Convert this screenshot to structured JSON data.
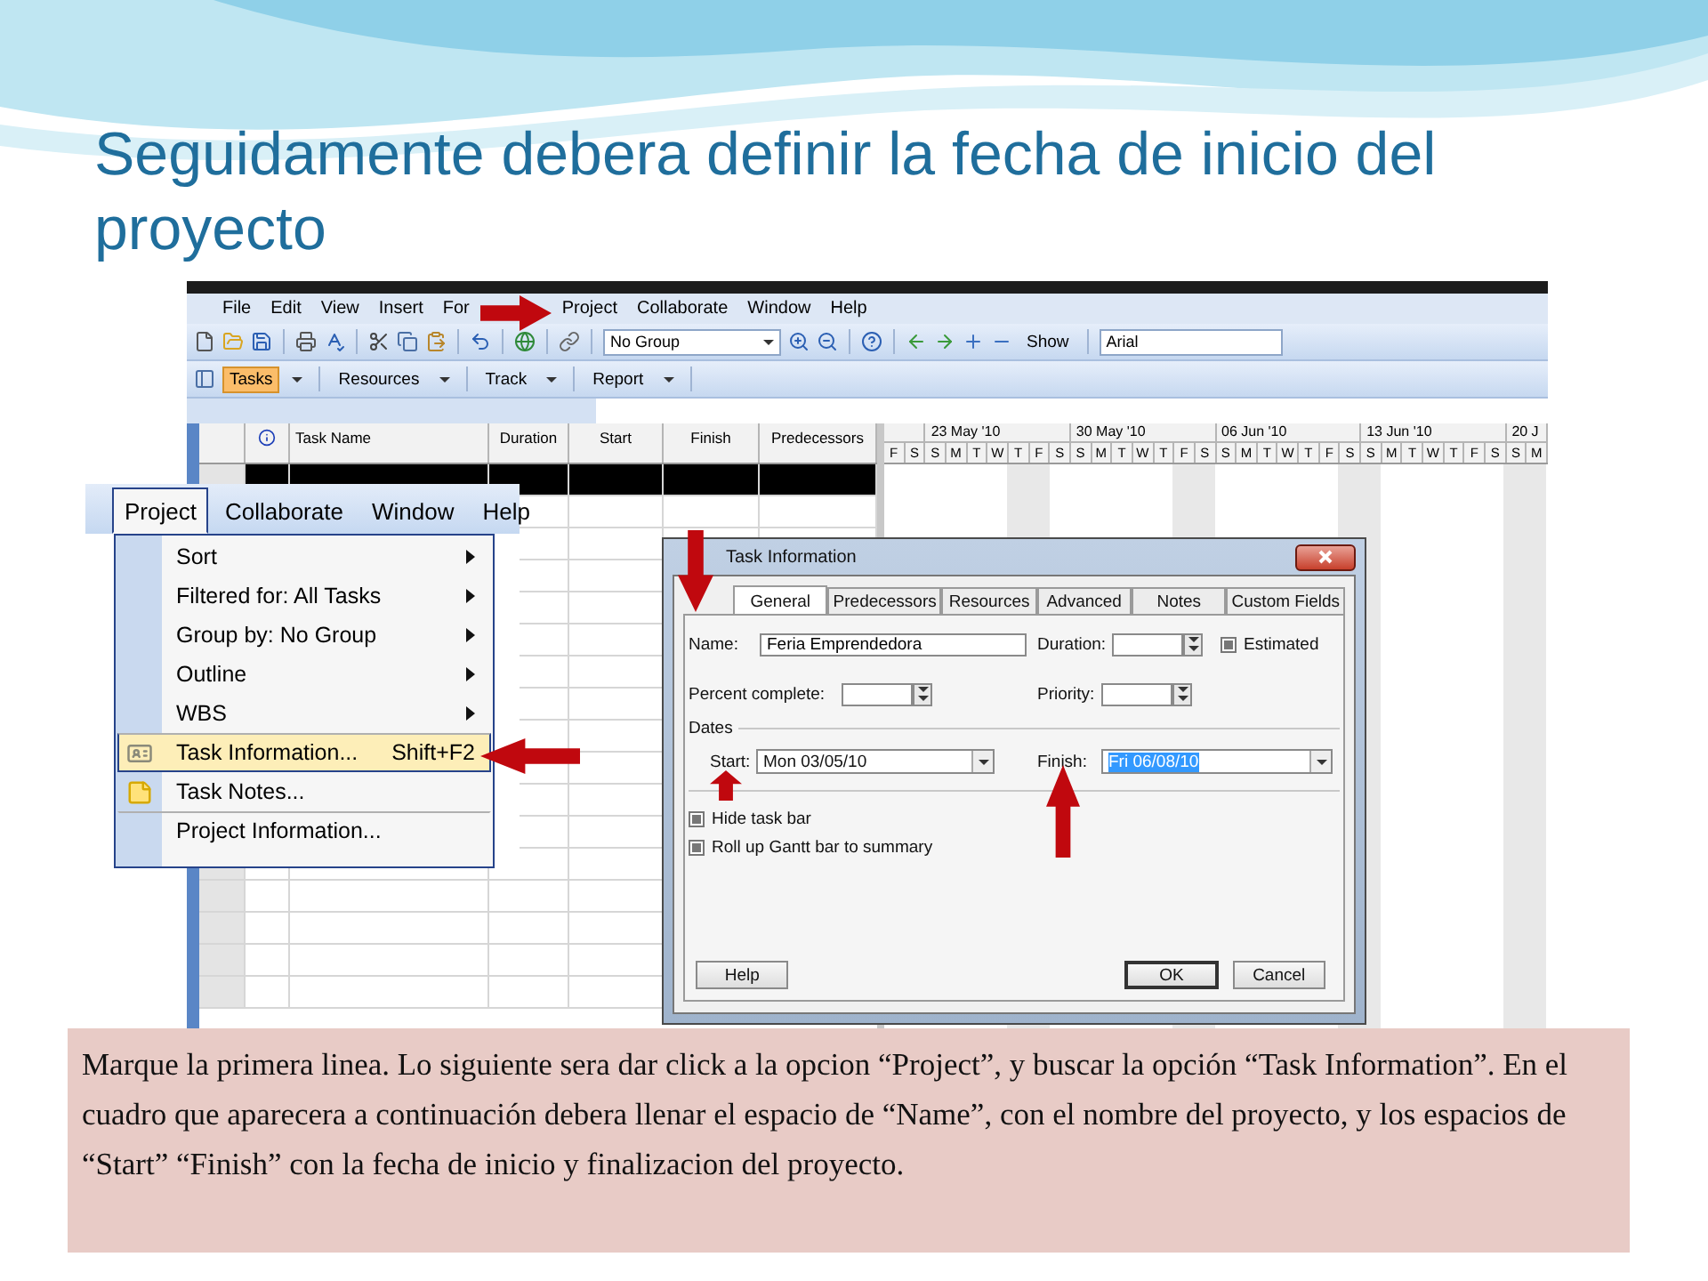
{
  "title": "Seguidamente debera definir la fecha de inicio del proyecto",
  "app": {
    "menu": [
      {
        "label": "File"
      },
      {
        "label": "Edit"
      },
      {
        "label": "View"
      },
      {
        "label": "Insert"
      },
      {
        "label": "For"
      }
    ],
    "menu_after_arrow": [
      {
        "label": "Project"
      },
      {
        "label": "Collaborate"
      },
      {
        "label": "Window"
      },
      {
        "label": "Help"
      }
    ],
    "group_box": "No Group",
    "show_button": "Show",
    "font_box": "Arial",
    "view_tabs": [
      {
        "label": "Tasks",
        "selected": true
      },
      {
        "label": "Resources",
        "selected": false
      },
      {
        "label": "Track",
        "selected": false
      },
      {
        "label": "Report",
        "selected": false
      }
    ],
    "columns": [
      "Task Name",
      "Duration",
      "Start",
      "Finish",
      "Predecessors"
    ],
    "weeks": [
      "23 May '10",
      "30 May '10",
      "06 Jun '10",
      "13 Jun '10",
      "20 J"
    ],
    "days": [
      "F",
      "S",
      "S",
      "M",
      "T",
      "W",
      "T",
      "F",
      "S",
      "S",
      "M",
      "T",
      "W",
      "T",
      "F",
      "S",
      "S",
      "M",
      "T",
      "W",
      "T",
      "F",
      "S",
      "S",
      "M",
      "T",
      "W",
      "T",
      "F",
      "S",
      "S",
      "M"
    ],
    "rows": [
      {
        "selected": true
      },
      {
        "selected": false
      },
      {
        "selected": false
      },
      {
        "selected": false
      },
      {
        "selected": false
      },
      {
        "selected": false
      },
      {
        "selected": false
      },
      {
        "selected": false
      },
      {
        "selected": false
      },
      {
        "selected": false
      },
      {
        "selected": false
      },
      {
        "selected": false
      },
      {
        "selected": false
      },
      {
        "selected": false
      },
      {
        "selected": false
      },
      {
        "selected": false
      },
      {
        "selected": false
      }
    ]
  },
  "menu_inset": {
    "menubar": [
      {
        "label": "Project",
        "selected": true
      },
      {
        "label": "Collaborate",
        "selected": false
      },
      {
        "label": "Window",
        "selected": false
      },
      {
        "label": "Help",
        "selected": false
      }
    ],
    "items": [
      {
        "label": "Sort",
        "kind": "submenu",
        "selected": false,
        "separator_before": false
      },
      {
        "label": "Filtered for: All Tasks",
        "kind": "submenu",
        "selected": false,
        "separator_before": false
      },
      {
        "label": "Group by: No Group",
        "kind": "submenu",
        "selected": false,
        "separator_before": false
      },
      {
        "label": "Outline",
        "kind": "submenu",
        "selected": false,
        "separator_before": false
      },
      {
        "label": "WBS",
        "kind": "submenu",
        "selected": false,
        "separator_before": false
      },
      {
        "label": "Task Information...",
        "shortcut": "Shift+F2",
        "kind": "form",
        "selected": true,
        "separator_before": true
      },
      {
        "label": "Task Notes...",
        "kind": "note",
        "selected": false,
        "separator_before": false
      },
      {
        "label": "Project Information...",
        "kind": "plain",
        "selected": false,
        "separator_before": true
      }
    ]
  },
  "dialog": {
    "title": "Task Information",
    "tabs": [
      {
        "label": "General",
        "selected": true
      },
      {
        "label": "Predecessors",
        "selected": false
      },
      {
        "label": "Resources",
        "selected": false
      },
      {
        "label": "Advanced",
        "selected": false
      },
      {
        "label": "Notes",
        "selected": false
      },
      {
        "label": "Custom Fields",
        "selected": false
      }
    ],
    "name": {
      "label": "Name:",
      "value": "Feria Emprendedora"
    },
    "duration": {
      "label": "Duration:"
    },
    "estimated": {
      "label": "Estimated",
      "checked": true
    },
    "percent": {
      "label": "Percent complete:"
    },
    "priority": {
      "label": "Priority:"
    },
    "dates_label": "Dates",
    "start": {
      "label": "Start:",
      "value": "Mon 03/05/10",
      "highlighted": false
    },
    "finish": {
      "label": "Finish:",
      "value": "Fri 06/08/10",
      "highlighted": true
    },
    "options": [
      {
        "label": "Hide task bar",
        "checked": true
      },
      {
        "label": "Roll up Gantt bar to summary",
        "checked": true
      }
    ],
    "buttons": [
      {
        "label": "Help",
        "default": false
      },
      {
        "label": "OK",
        "default": true
      },
      {
        "label": "Cancel",
        "default": false
      }
    ]
  },
  "caption": "Marque la primera linea. Lo siguiente sera dar click a la opcion “Project”, y buscar la opción “Task Information”. En el cuadro que aparecera a continuación debera llenar el espacio de “Name”, con el nombre del proyecto, y los espacios de “Start”  “Finish” con la fecha de inicio y finalizacion del proyecto."
}
